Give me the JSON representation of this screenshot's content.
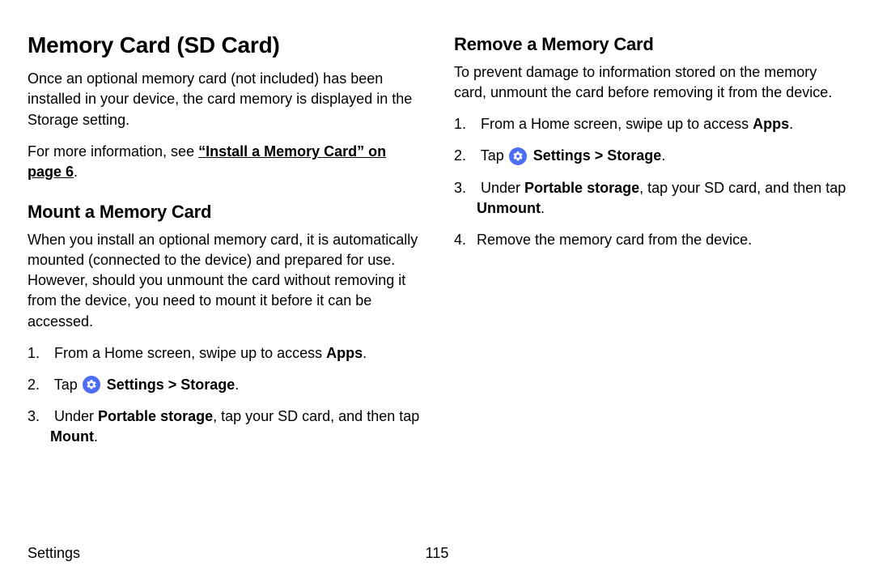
{
  "left": {
    "title": "Memory Card (SD Card)",
    "intro": "Once an optional memory card (not included) has been installed in your device, the card memory is displayed in the Storage setting.",
    "moreinfo_prefix": "For more information, see ",
    "moreinfo_link": "“Install a Memory Card” on page 6",
    "moreinfo_suffix": ".",
    "mount_heading": "Mount a Memory Card",
    "mount_intro": "When you install an optional memory card, it is automatically mounted (connected to the device) and prepared for use. However, should you unmount the card without removing it from the device, you need to mount it before it can be accessed.",
    "step1_prefix": "From a Home screen, swipe up to access ",
    "step1_bold": "Apps",
    "step1_suffix": ".",
    "step2_prefix": "Tap ",
    "step2_bold": "Settings > Storage",
    "step2_suffix": ".",
    "step3_prefix": "Under ",
    "step3_bold1": "Portable storage",
    "step3_mid": ", tap your SD card, and then tap ",
    "step3_bold2": "Mount",
    "step3_suffix": "."
  },
  "right": {
    "heading": "Remove a Memory Card",
    "intro": "To prevent damage to information stored on the memory card, unmount the card before removing it from the device.",
    "step1_prefix": "From a Home screen, swipe up to access ",
    "step1_bold": "Apps",
    "step1_suffix": ".",
    "step2_prefix": "Tap ",
    "step2_bold": "Settings > Storage",
    "step2_suffix": ".",
    "step3_prefix": "Under ",
    "step3_bold1": "Portable storage",
    "step3_mid": ", tap your SD card, and then tap ",
    "step3_bold2": "Unmount",
    "step3_suffix": ".",
    "step4": "Remove the memory card from the device."
  },
  "footer": {
    "section": "Settings",
    "page": "115"
  }
}
